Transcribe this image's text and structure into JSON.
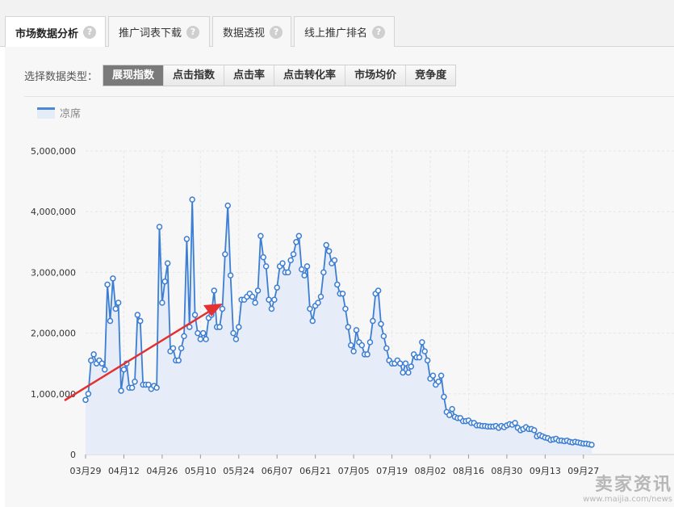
{
  "tabs": [
    {
      "label": "市场数据分析",
      "active": true
    },
    {
      "label": "推广词表下载",
      "active": false
    },
    {
      "label": "数据透视",
      "active": false
    },
    {
      "label": "线上推广排名",
      "active": false
    }
  ],
  "help_icon": "?",
  "filter": {
    "label": "选择数据类型：",
    "options": [
      "展现指数",
      "点击指数",
      "点击率",
      "点击转化率",
      "市场均价",
      "竞争度"
    ],
    "selected": 0
  },
  "watermark": {
    "title": "卖家资讯",
    "url": "www.maijia.com/news"
  },
  "colors": {
    "line": "#3c7ed3",
    "area": "#e3ebf7",
    "arrow": "#e33030"
  },
  "chart_data": {
    "type": "area",
    "legend": [
      "凉席"
    ],
    "x_tick_labels": [
      "03月29",
      "04月12",
      "04月26",
      "05月10",
      "05月24",
      "06月07",
      "06月21",
      "07月05",
      "07月19",
      "08月02",
      "08月16",
      "08月30",
      "09月13",
      "09月27"
    ],
    "y_tick_labels": [
      "0",
      "1,000,000",
      "2,000,000",
      "3,000,000",
      "4,000,000",
      "5,000,000"
    ],
    "ylim": [
      0,
      5000000
    ],
    "grid": true,
    "annotation": "red arrow pointing up toward the rising trend",
    "series": [
      {
        "name": "凉席",
        "start_date": "03-29",
        "values": [
          900000,
          1000000,
          1550000,
          1650000,
          1500000,
          1550000,
          1500000,
          1400000,
          2800000,
          2200000,
          2900000,
          2400000,
          2500000,
          1050000,
          1400000,
          1500000,
          1100000,
          1100000,
          1200000,
          2300000,
          2200000,
          1150000,
          1150000,
          1150000,
          1080000,
          1130000,
          1100000,
          3750000,
          2500000,
          2850000,
          3150000,
          1700000,
          1750000,
          1550000,
          1550000,
          1750000,
          1950000,
          3550000,
          2100000,
          4200000,
          2300000,
          2000000,
          1900000,
          2000000,
          1900000,
          2250000,
          2300000,
          2700000,
          2100000,
          2100000,
          2400000,
          3300000,
          4100000,
          2950000,
          2000000,
          1900000,
          2100000,
          2550000,
          2550000,
          2600000,
          2650000,
          2600000,
          2500000,
          2700000,
          3600000,
          3250000,
          3100000,
          2550000,
          2400000,
          2550000,
          2750000,
          3100000,
          3150000,
          3000000,
          3000000,
          3200000,
          3300000,
          3500000,
          3600000,
          3050000,
          2950000,
          3100000,
          2400000,
          2200000,
          2450000,
          2500000,
          2600000,
          3000000,
          3450000,
          3350000,
          3150000,
          3200000,
          2800000,
          2650000,
          2650000,
          2400000,
          2100000,
          1800000,
          1700000,
          2050000,
          1850000,
          1800000,
          1650000,
          1650000,
          1850000,
          2200000,
          2650000,
          2700000,
          2150000,
          1950000,
          1750000,
          1550000,
          1500000,
          1500000,
          1550000,
          1500000,
          1350000,
          1500000,
          1350000,
          1450000,
          1650000,
          1600000,
          1600000,
          1850000,
          1700000,
          1550000,
          1250000,
          1300000,
          1150000,
          1200000,
          1300000,
          950000,
          700000,
          650000,
          750000,
          620000,
          600000,
          600000,
          550000,
          550000,
          560000,
          520000,
          520000,
          480000,
          480000,
          470000,
          470000,
          460000,
          460000,
          460000,
          470000,
          440000,
          470000,
          450000,
          480000,
          500000,
          490000,
          520000,
          440000,
          400000,
          420000,
          450000,
          420000,
          420000,
          400000,
          300000,
          320000,
          300000,
          280000,
          270000,
          240000,
          250000,
          260000,
          230000,
          230000,
          220000,
          230000,
          210000,
          200000,
          210000,
          200000,
          190000,
          180000,
          180000,
          170000,
          160000
        ]
      }
    ]
  }
}
